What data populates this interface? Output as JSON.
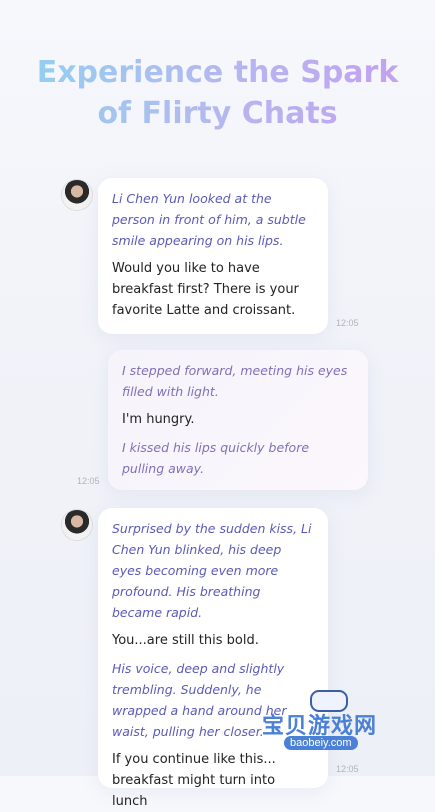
{
  "header": {
    "line1": "Experience the Spark",
    "line2": "of Flirty Chats"
  },
  "messages": [
    {
      "sender": "character",
      "action1": "Li Chen Yun looked at the person in front of him, a subtle smile appearing on his lips.",
      "speech1": "Would you like to have breakfast first? There is your favorite Latte and croissant.",
      "time": "12:05"
    },
    {
      "sender": "user",
      "action1": "I stepped forward, meeting his eyes filled with light.",
      "speech1": "I'm hungry.",
      "action2": "I kissed his lips quickly before pulling away.",
      "time": "12:05"
    },
    {
      "sender": "character",
      "action1": "Surprised by the sudden kiss, Li Chen Yun blinked, his deep eyes becoming even more profound. His breathing became rapid.",
      "speech1": "You...are still this bold.",
      "action2": "His voice, deep and slightly trembling. Suddenly, he wrapped a hand around her waist, pulling her closer.",
      "speech2": "If you continue like this... breakfast might turn into lunch",
      "time": "12:05"
    }
  ],
  "watermark": {
    "text": "宝贝游戏网",
    "url": "baobeiy.com"
  },
  "icons": {
    "avatar": "character-avatar",
    "watermark": "gamepad-icon"
  }
}
